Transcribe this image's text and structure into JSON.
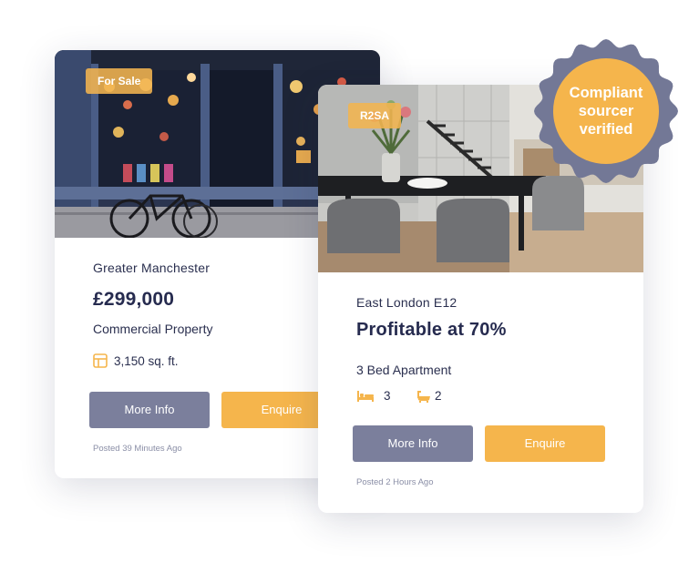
{
  "cards": [
    {
      "tag": "For Sale",
      "location": "Greater Manchester",
      "headline": "£299,000",
      "property_type": "Commercial Property",
      "area": "3,150 sq. ft.",
      "more_info_label": "More Info",
      "enquire_label": "Enquire",
      "posted": "Posted 39 Minutes Ago"
    },
    {
      "tag": "R2SA",
      "location": "East London E12",
      "headline": "Profitable at 70%",
      "property_type": "3 Bed Apartment",
      "bedrooms": "3",
      "bathrooms": "2",
      "more_info_label": "More Info",
      "enquire_label": "Enquire",
      "posted": "Posted 2 Hours Ago"
    }
  ],
  "badge": {
    "lines": [
      "Compliant",
      "sourcer",
      "verified"
    ]
  },
  "icons": {
    "area": "floorplan-icon",
    "bedrooms": "bed-icon",
    "bathrooms": "bathtub-icon",
    "badge": "seal-badge-icon"
  },
  "colors": {
    "accent": "#f5b54c",
    "secondary_button": "#7b7f9c",
    "heading_text": "#262b4f",
    "badge_ring": "#737896"
  }
}
